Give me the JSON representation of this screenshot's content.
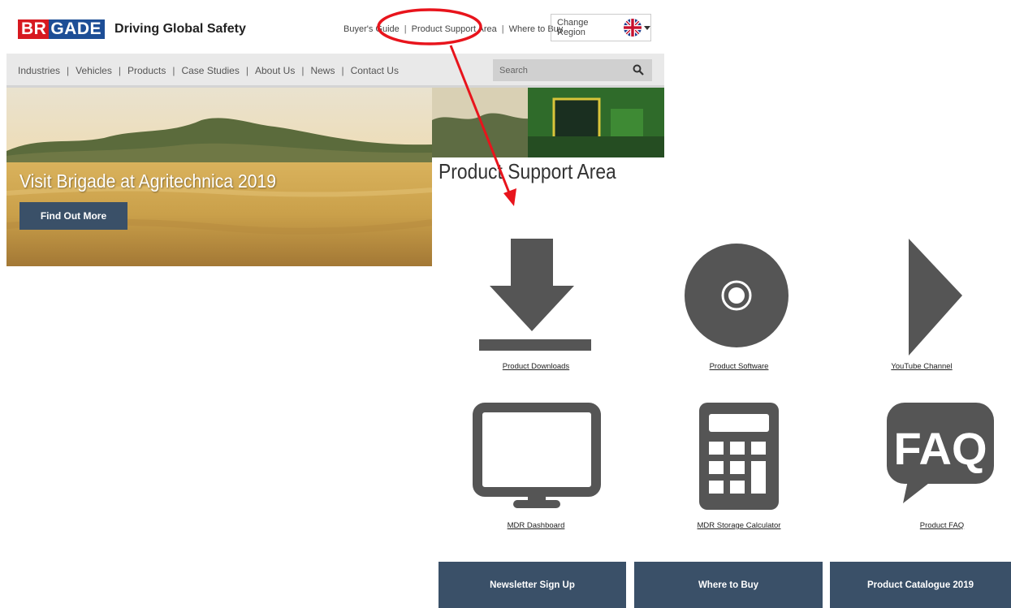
{
  "header": {
    "logo": {
      "part1": "BR",
      "part2": "GADE",
      "tm": "®"
    },
    "tagline": "Driving Global Safety",
    "top_links": [
      "Buyer's Guide",
      "Product Support Area",
      "Where to Buy"
    ],
    "region_label": "Change Region"
  },
  "nav": {
    "items": [
      "Industries",
      "Vehicles",
      "Products",
      "Case Studies",
      "About Us",
      "News",
      "Contact Us"
    ],
    "search_placeholder": "Search"
  },
  "hero": {
    "title": "Visit Brigade at Agritechnica 2019",
    "button_label": "Find Out More"
  },
  "support": {
    "title": "Product Support Area",
    "tiles": [
      {
        "label": "Product Downloads",
        "icon": "download-icon"
      },
      {
        "label": "Product Software",
        "icon": "disc-icon"
      },
      {
        "label": "YouTube Channel",
        "icon": "play-icon"
      },
      {
        "label": "MDR Dashboard",
        "icon": "monitor-icon"
      },
      {
        "label": "MDR Storage Calculator",
        "icon": "calculator-icon"
      },
      {
        "label": "Product FAQ",
        "icon": "faq-icon"
      }
    ],
    "faq_icon_text": "FAQ"
  },
  "footer_buttons": [
    "Newsletter Sign Up",
    "Where to Buy",
    "Product Catalogue 2019"
  ],
  "colors": {
    "brand_red": "#d71920",
    "brand_blue": "#1d4e96",
    "button": "#3a5068",
    "icon_grey": "#555555",
    "annotation": "#e8141c"
  }
}
